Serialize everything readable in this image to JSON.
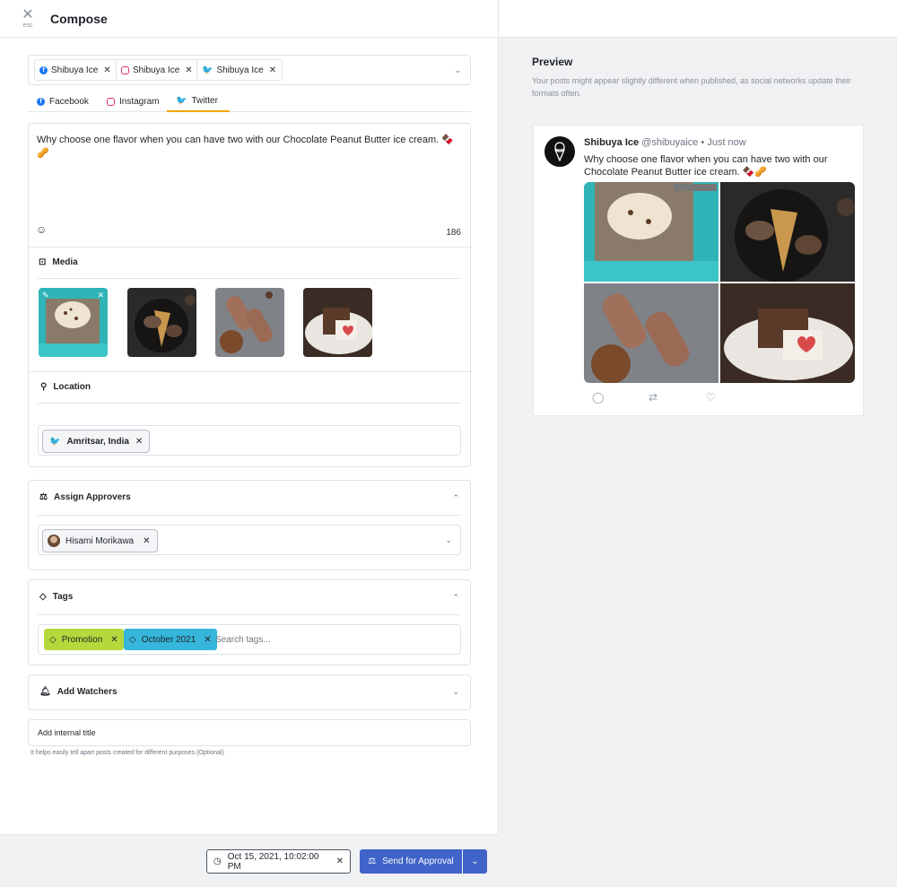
{
  "header": {
    "close_glyph": "✕",
    "close_sub": "esc",
    "title": "Compose"
  },
  "accounts": [
    {
      "network": "facebook",
      "name": "Shibuya Ice"
    },
    {
      "network": "instagram",
      "name": "Shibuya Ice"
    },
    {
      "network": "twitter",
      "name": "Shibuya Ice"
    }
  ],
  "tabs": [
    {
      "label": "Facebook",
      "active": false
    },
    {
      "label": "Instagram",
      "active": false
    },
    {
      "label": "Twitter",
      "active": true
    }
  ],
  "editor": {
    "text": "Why choose one flavor when you can have two with our Chocolate Peanut Butter ice cream. 🍫🥜",
    "char_count": "186"
  },
  "media": {
    "label": "Media"
  },
  "location": {
    "label": "Location",
    "value": "Amritsar, India"
  },
  "approvers": {
    "label": "Assign Approvers",
    "user": "Hisami Morikawa"
  },
  "tags": {
    "label": "Tags",
    "items": [
      "Promotion",
      "October 2021"
    ],
    "placeholder": "Search tags..."
  },
  "watchers": {
    "label": "Add Watchers"
  },
  "internal_title": {
    "placeholder": "Add internal title",
    "helper": "It helps easily tell apart posts created for different purposes.(Optional)"
  },
  "footer": {
    "datetime": "Oct 15, 2021, 10:02:00 PM",
    "send_label": "Send for Approval"
  },
  "preview": {
    "title": "Preview",
    "description": "Your posts might appear slightly different when published, as social networks update their formats often.",
    "tweet": {
      "name": "Shibuya Ice",
      "handle": "@shibuyaice",
      "time": "• Just now",
      "text": "Why choose one flavor when you can have two with our Chocolate Peanut Butter ice cream. 🍫🥜"
    }
  },
  "colors": {
    "accent": "#3f63c8",
    "tab_active": "#f0a500",
    "tag_green": "#b6d83d",
    "tag_blue": "#35b6da",
    "facebook": "#1877f2",
    "instagram": "#e1306c",
    "twitter": "#1da1f2"
  }
}
